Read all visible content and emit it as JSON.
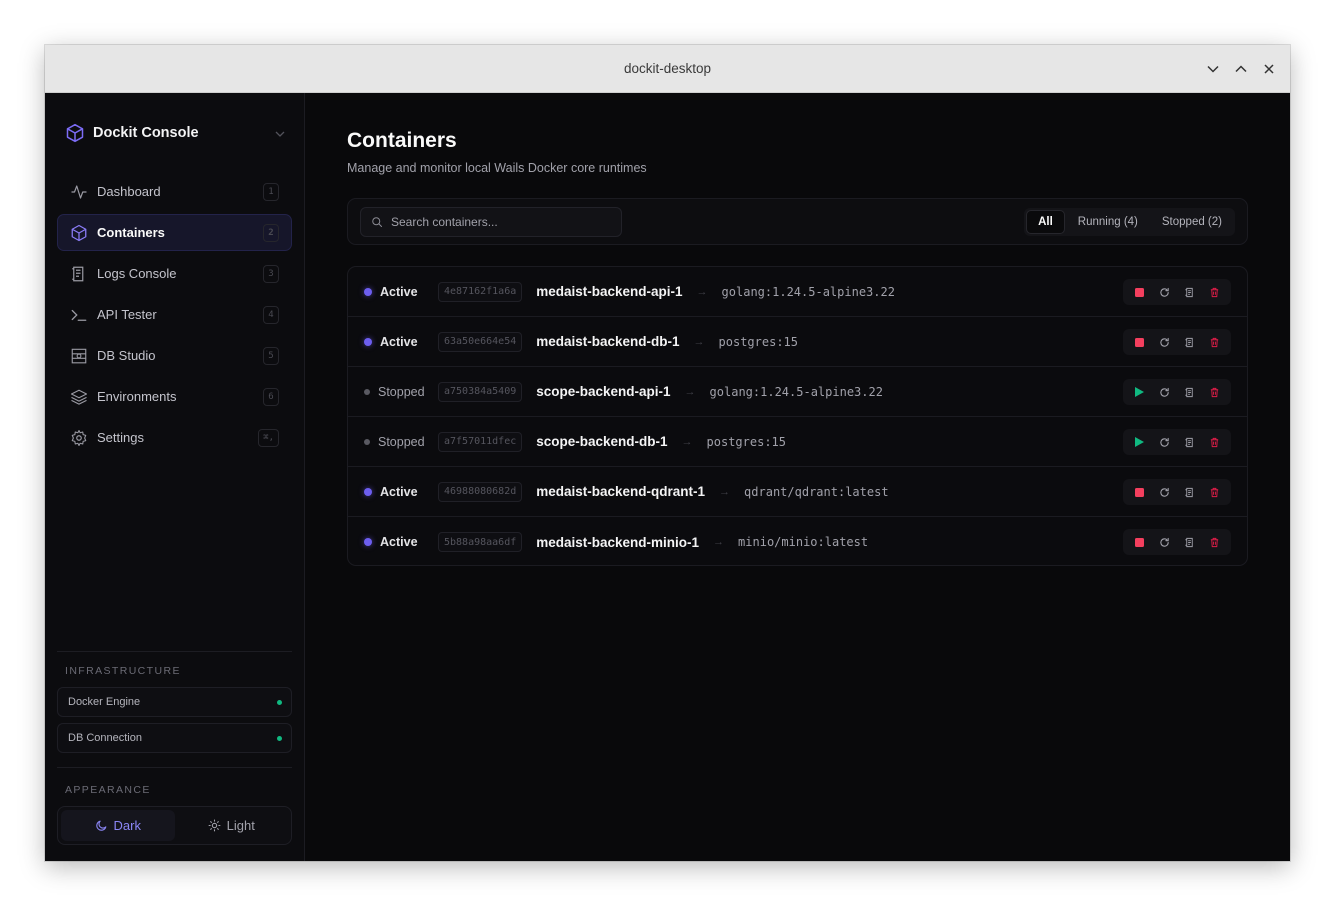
{
  "window": {
    "title": "dockit-desktop"
  },
  "sidebar": {
    "brand": "Dockit Console",
    "nav": [
      {
        "label": "Dashboard",
        "shortcut": "1",
        "icon": "activity-icon",
        "active": false
      },
      {
        "label": "Containers",
        "shortcut": "2",
        "icon": "cube-icon",
        "active": true
      },
      {
        "label": "Logs Console",
        "shortcut": "3",
        "icon": "logs-icon",
        "active": false
      },
      {
        "label": "API Tester",
        "shortcut": "4",
        "icon": "terminal-icon",
        "active": false
      },
      {
        "label": "DB Studio",
        "shortcut": "5",
        "icon": "database-icon",
        "active": false
      },
      {
        "label": "Environments",
        "shortcut": "6",
        "icon": "layers-icon",
        "active": false
      },
      {
        "label": "Settings",
        "shortcut": "⌘,",
        "icon": "gear-icon",
        "active": false
      }
    ],
    "infrastructure_label": "INFRASTRUCTURE",
    "infrastructure": [
      {
        "label": "Docker Engine",
        "status_color": "#10b981"
      },
      {
        "label": "DB Connection",
        "status_color": "#10b981"
      }
    ],
    "appearance_label": "APPEARANCE",
    "theme": {
      "dark_label": "Dark",
      "light_label": "Light",
      "selected": "Dark"
    }
  },
  "main": {
    "title": "Containers",
    "subtitle": "Manage and monitor local Wails Docker core runtimes",
    "search": {
      "placeholder": "Search containers..."
    },
    "filters": [
      {
        "label": "All",
        "selected": true
      },
      {
        "label": "Running (4)",
        "selected": false
      },
      {
        "label": "Stopped (2)",
        "selected": false
      }
    ],
    "containers": [
      {
        "status": "Active",
        "id": "4e87162f1a6a",
        "name": "medaist-backend-api-1",
        "image": "golang:1.24.5-alpine3.22"
      },
      {
        "status": "Active",
        "id": "63a50e664e54",
        "name": "medaist-backend-db-1",
        "image": "postgres:15"
      },
      {
        "status": "Stopped",
        "id": "a750384a5409",
        "name": "scope-backend-api-1",
        "image": "golang:1.24.5-alpine3.22"
      },
      {
        "status": "Stopped",
        "id": "a7f57011dfec",
        "name": "scope-backend-db-1",
        "image": "postgres:15"
      },
      {
        "status": "Active",
        "id": "46988080682d",
        "name": "medaist-backend-qdrant-1",
        "image": "qdrant/qdrant:latest"
      },
      {
        "status": "Active",
        "id": "5b88a98aa6df",
        "name": "medaist-backend-minio-1",
        "image": "minio/minio:latest"
      }
    ]
  },
  "colors": {
    "accent": "#6d5ef0",
    "stop": "#f43f5e",
    "start": "#10b981",
    "delete": "#e11d48"
  }
}
